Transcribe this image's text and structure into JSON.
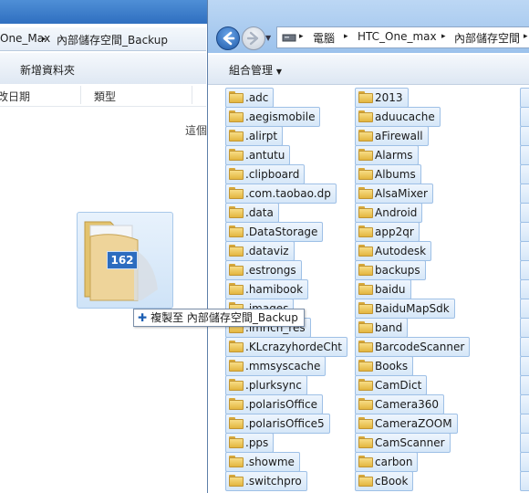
{
  "left_window": {
    "breadcrumb": [
      "One_Max",
      "內部儲存空間_Backup"
    ],
    "toolbar_button": "新增資料夾",
    "columns": [
      "改日期",
      "類型"
    ],
    "empty_text": "這個"
  },
  "drag": {
    "count_badge": "162",
    "copy_tooltip": "複製至 內部儲存空間_Backup"
  },
  "right_window": {
    "breadcrumb": [
      "電腦",
      "HTC_One_max",
      "內部儲存空間"
    ],
    "toolbar_button": "組合管理",
    "column1": [
      ".adc",
      ".aegismobile",
      ".alirpt",
      ".antutu",
      ".clipboard",
      ".com.taobao.dp",
      ".data",
      ".DataStorage",
      ".dataviz",
      ".estrongs",
      ".hamibook",
      ".images",
      ".imrich_res",
      ".KLcrazyhordeCht",
      ".mmsyscache",
      ".plurksync",
      ".polarisOffice",
      ".polarisOffice5",
      ".pps",
      ".showme",
      ".switchpro"
    ],
    "column2": [
      "2013",
      "aduucache",
      "aFirewall",
      "Alarms",
      "Albums",
      "AlsaMixer",
      "Android",
      "app2qr",
      "Autodesk",
      "backups",
      "baidu",
      "BaiduMapSdk",
      "band",
      "BarcodeScanner",
      "Books",
      "CamDict",
      "Camera360",
      "CameraZOOM",
      "CamScanner",
      "carbon",
      "cBook"
    ]
  },
  "colors": {
    "title_blue": "#9cc2ec",
    "item_border": "#9ec0e6",
    "folder_yellow": "#e3b63f"
  }
}
